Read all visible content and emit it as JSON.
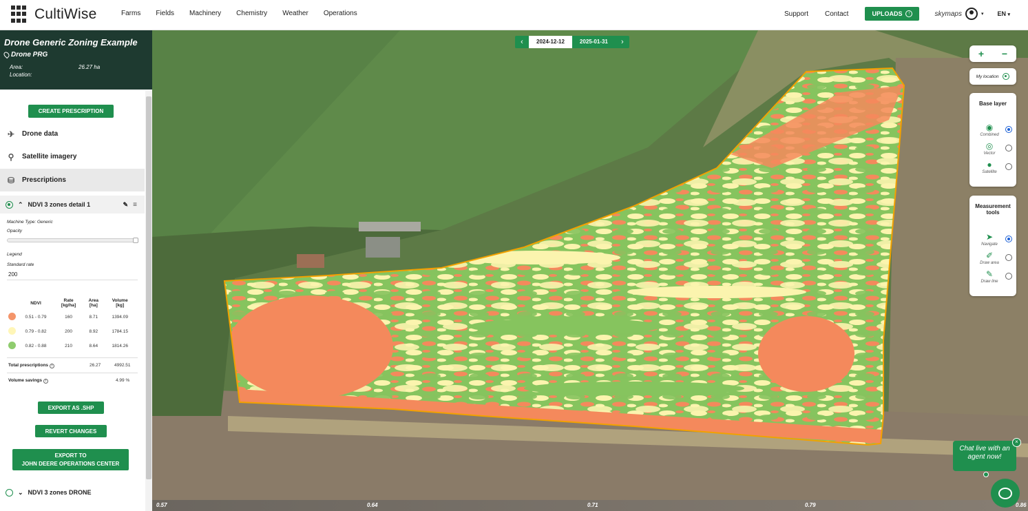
{
  "brand": {
    "name": "CultiWise"
  },
  "nav": {
    "items": [
      "Farms",
      "Fields",
      "Machinery",
      "Chemistry",
      "Weather",
      "Operations"
    ],
    "support": "Support",
    "contact": "Contact",
    "uploads": "UPLOADS",
    "skymaps": "skymaps",
    "lang": "EN"
  },
  "field": {
    "title": "Drone Generic Zoning Example",
    "subtitle": "Drone PRG",
    "area_label": "Area:",
    "area_value": "26.27 ha",
    "location_label": "Location:",
    "location_value": ""
  },
  "sidebar": {
    "create_prescription": "CREATE PRESCRIPTION",
    "menu": [
      {
        "label": "Drone data",
        "icon": "drone-icon"
      },
      {
        "label": "Satellite imagery",
        "icon": "satellite-icon"
      },
      {
        "label": "Prescriptions",
        "icon": "sprayer-icon"
      }
    ],
    "prescription": {
      "name": "NDVI 3 zones detail 1",
      "machine_type": "Machine Type: Generic",
      "opacity_label": "Opacity",
      "opacity": 1.0,
      "legend_label": "Legend",
      "standard_rate_label": "Standard rate",
      "standard_rate_value": "200",
      "table": {
        "headers": [
          "NDVI",
          "Rate\n[kg/ha]",
          "Area\n[ha]",
          "Volume\n[kg]"
        ],
        "rows": [
          {
            "color": "#f4956a",
            "ndvi": "0.51 - 0.79",
            "rate": "160",
            "area": "8.71",
            "volume": "1394.09"
          },
          {
            "color": "#fff6b8",
            "ndvi": "0.79 - 0.82",
            "rate": "200",
            "area": "8.92",
            "volume": "1784.15"
          },
          {
            "color": "#8fcc6e",
            "ndvi": "0.82 - 0.88",
            "rate": "210",
            "area": "8.64",
            "volume": "1814.26"
          }
        ]
      },
      "total_label": "Total prescriptions",
      "total_area": "26.27",
      "total_volume": "4992.51",
      "savings_label": "Volume savings",
      "savings_value": "4.99 %"
    },
    "export_shp": "EXPORT AS .SHP",
    "revert": "REVERT CHANGES",
    "export_jd_line1": "EXPORT TO",
    "export_jd_line2": "JOHN DEERE OPERATIONS CENTER",
    "other_prescription": "NDVI 3 zones DRONE"
  },
  "map": {
    "dates": [
      "2024-12-12",
      "2025-01-31"
    ],
    "selected_date": "2024-12-12",
    "zoom_in": "+",
    "zoom_out": "−",
    "my_location": "My location",
    "base_layer_title": "Base layer",
    "base_layers": [
      {
        "label": "Combined",
        "selected": true
      },
      {
        "label": "Vector",
        "selected": false
      },
      {
        "label": "Satellite",
        "selected": false
      }
    ],
    "measurement_title": "Measurement tools",
    "tools": [
      {
        "label": "Navigate",
        "selected": true
      },
      {
        "label": "Draw area",
        "selected": false
      },
      {
        "label": "Draw line",
        "selected": false
      }
    ],
    "scale_labels": [
      "0.57",
      "0.64",
      "0.71",
      "0.79",
      "0.86"
    ],
    "zone_colors": {
      "low": "#f4895c",
      "mid": "#fbf4ae",
      "high": "#86c45e",
      "border": "#f2a100"
    }
  },
  "chat": {
    "text": "Chat live with an agent now!",
    "close": "×"
  }
}
